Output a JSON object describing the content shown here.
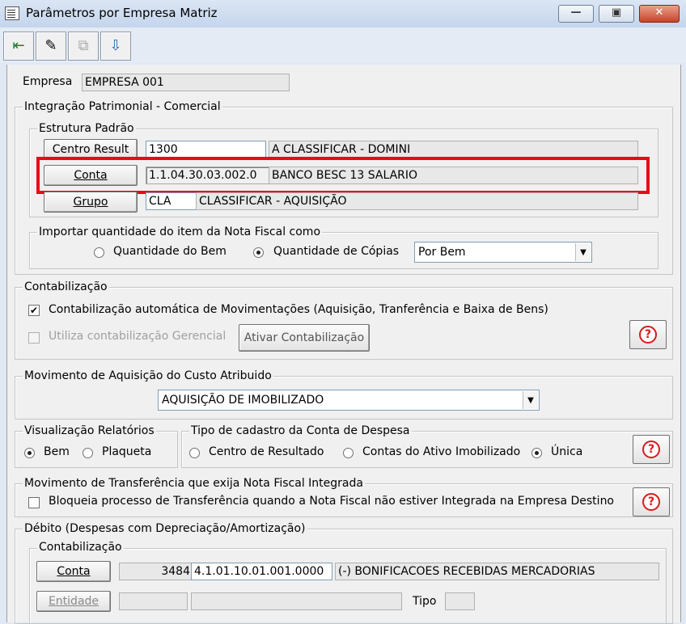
{
  "window": {
    "title": "Parâmetros por Empresa Matriz",
    "minimize": "▭",
    "maximize": "▣",
    "close": "✕"
  },
  "toolbar": {
    "buttons": [
      "exit-icon",
      "edit-icon",
      "copy-icon",
      "save-icon"
    ]
  },
  "empresa": {
    "label": "Empresa",
    "value": "EMPRESA 001"
  },
  "integracao": {
    "title": "Integração Patrimonial - Comercial",
    "estrutura": {
      "title": "Estrutura Padrão",
      "centro": {
        "button": "Centro Result",
        "code": "1300",
        "desc": "A CLASSIFICAR - DOMINI"
      },
      "conta": {
        "button": "Conta",
        "code": "1.1.04.30.03.002.0",
        "desc": "BANCO BESC 13 SALARIO"
      },
      "grupo": {
        "button": "Grupo",
        "code": "CLA",
        "desc": "CLASSIFICAR - AQUISIÇÃO"
      }
    },
    "importar": {
      "title": "Importar quantidade do item da Nota Fiscal como",
      "opt1": "Quantidade do Bem",
      "opt2": "Quantidade de Cópias",
      "selected": "Quantidade de Cópias",
      "combo": "Por Bem"
    }
  },
  "contabilizacao": {
    "title": "Contabilização",
    "auto_label": "Contabilização automática de Movimentações (Aquisição, Tranferência e Baixa de Bens)",
    "auto_checked": true,
    "gerencial_label": "Utiliza contabilização Gerencial",
    "gerencial_checked": false,
    "ativar_button": "Ativar Contabilização"
  },
  "aquisicao": {
    "title": "Movimento de Aquisição do Custo Atribuido",
    "value": "AQUISIÇÃO DE IMOBILIZADO"
  },
  "visualizacao": {
    "title": "Visualização Relatórios",
    "opt1": "Bem",
    "opt2": "Plaqueta",
    "selected": "Bem"
  },
  "tipo_cadastro": {
    "title": "Tipo de cadastro da Conta de Despesa",
    "opt1": "Centro de Resultado",
    "opt2": "Contas do Ativo Imobilizado",
    "opt3": "Única",
    "selected": "Única"
  },
  "transferencia": {
    "title": "Movimento de Transferência que exija Nota Fiscal Integrada",
    "check_label": "Bloqueia processo de Transferência quando a Nota Fiscal não estiver Integrada na Empresa Destino",
    "checked": false
  },
  "debito": {
    "title": "Débito (Despesas com Depreciação/Amortização)",
    "contab": {
      "title": "Contabilização",
      "conta_button": "Conta",
      "conta_num": "3484",
      "conta_code": "4.1.01.10.01.001.0000",
      "conta_desc": "(-) BONIFICACOES RECEBIDAS MERCADORIAS",
      "entidade_button": "Entidade",
      "tipo_label": "Tipo"
    }
  },
  "help_symbol": "?",
  "colors": {
    "highlight": "#e8091a",
    "help": "#d8191c"
  }
}
